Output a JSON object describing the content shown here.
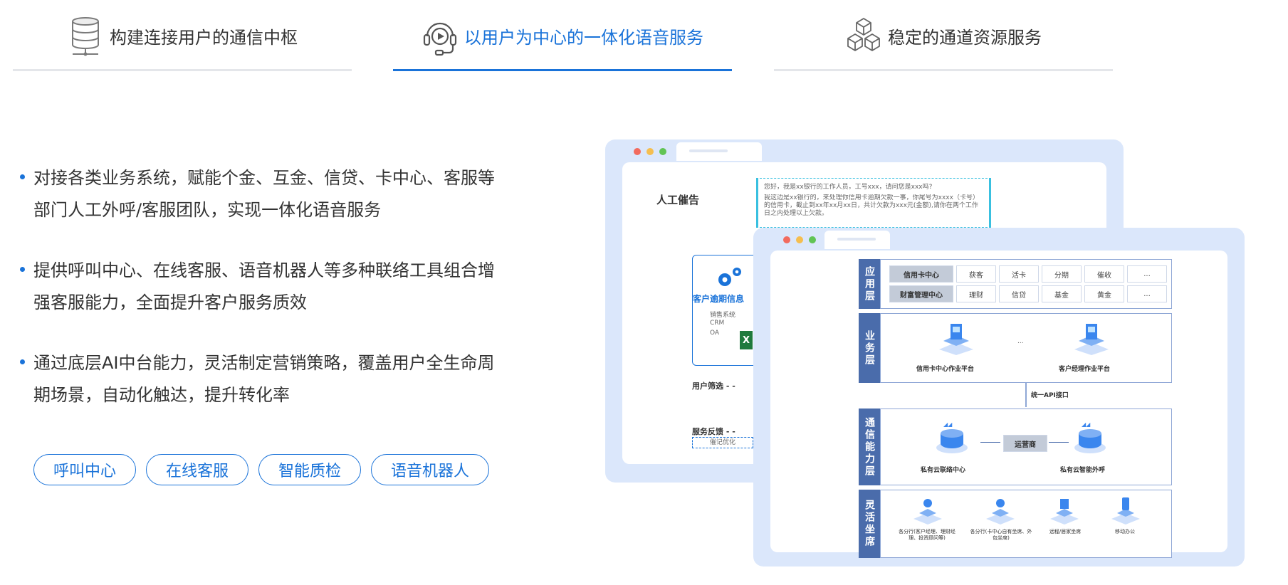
{
  "tabs": [
    {
      "label": "构建连接用户的通信中枢",
      "icon": "server-database-icon",
      "active": false
    },
    {
      "label": "以用户为中心的一体化语音服务",
      "icon": "headset-video-icon",
      "active": true
    },
    {
      "label": "稳定的通道资源服务",
      "icon": "cubes-stack-icon",
      "active": false
    }
  ],
  "bullets": [
    "对接各类业务系统，赋能个金、互金、信贷、卡中心、客服等部门人工外呼/客服团队，实现一体化语音服务",
    "提供呼叫中心、在线客服、语音机器人等多种联络工具组合增强客服能力，全面提升客户服务质效",
    "通过底层AI中台能力，灵活制定营销策略，覆盖用户全生命周期场景，自动化触达，提升转化率"
  ],
  "pills": [
    "呼叫中心",
    "在线客服",
    "智能质检",
    "语音机器人"
  ],
  "colors": {
    "accent": "#1a73d9",
    "inactive_line": "#e4e6ea",
    "frame": "#dbe7fb",
    "layer": "#4a6cab"
  },
  "back_window": {
    "title": "人工催告",
    "chat_line1": "您好，我是xx银行的工作人员，工号xxx，请问您是xxx吗?",
    "chat_line2": "我这边是xx银行的，来处理你信用卡逾期欠款一事，你尾号为xxxx（卡号）的信用卡，截止到xx年xx月xx日，共计欠款为xxx元(金额),请你在两个工作日之内处理以上欠款。",
    "card_title": "客户逾期信息",
    "card_items": [
      "销售系统",
      "CRM",
      "OA"
    ],
    "filter_label": "用户筛选",
    "feedback_label": "服务反馈",
    "feedback_sub": "催记优化"
  },
  "front_window": {
    "app_layer": "应用层",
    "app_row1": [
      "信用卡中心",
      "获客",
      "活卡",
      "分期",
      "催收",
      "..."
    ],
    "app_row2": [
      "财富管理中心",
      "理财",
      "信贷",
      "基金",
      "黄金",
      "..."
    ],
    "biz_layer": "业务层",
    "biz_left": "信用卡中心作业平台",
    "biz_dots": "...",
    "biz_right": "客户经理作业平台",
    "api": "统一API接口",
    "comm_layer": "通信能力层",
    "comm_left": "私有云联络中心",
    "comm_mid": "运营商",
    "comm_right": "私有云智能外呼",
    "seat_layer": "灵活坐席",
    "seats": [
      "各分行(客户经理、理财经理、投资顾问等)",
      "各分行(卡中心自有坐席、外包坐席)",
      "远程/居家坐席",
      "移动办公"
    ]
  }
}
